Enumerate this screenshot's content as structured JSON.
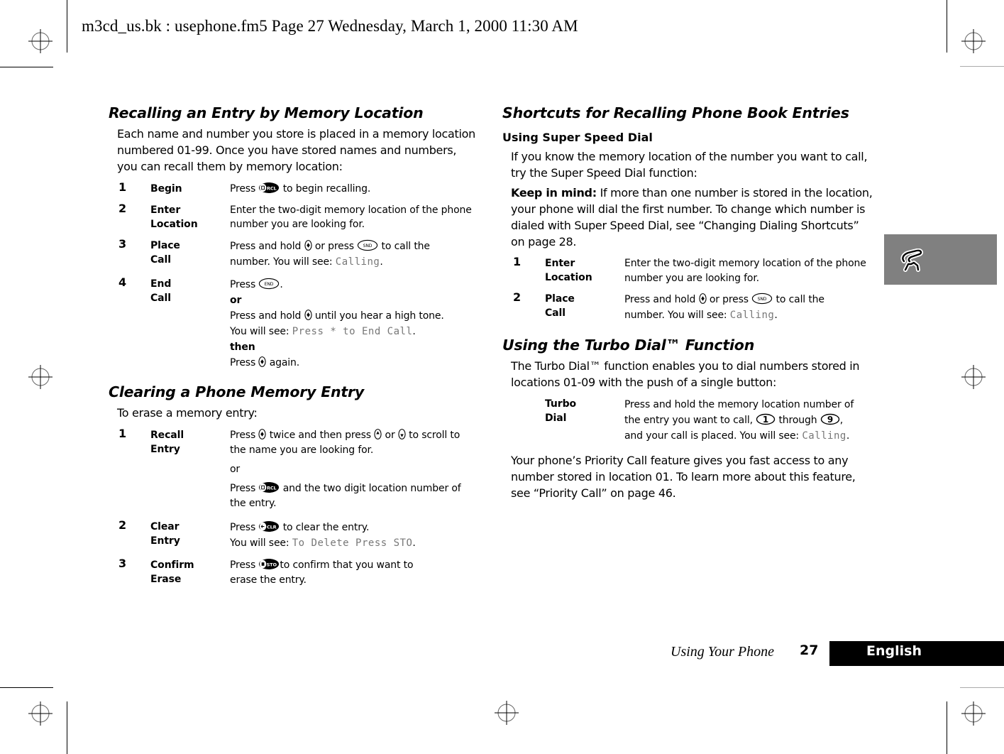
{
  "header": {
    "print_line": "m3cd_us.bk : usephone.fm5  Page 27  Wednesday, March 1, 2000  11:30 AM"
  },
  "left": {
    "recall_section": {
      "title": "Recalling an Entry by Memory Location",
      "intro_lines": [
        "Each name and number you store is placed in a memory location",
        "numbered 01-99. Once you have stored names and numbers,",
        "you can recall them by memory location:"
      ],
      "steps": [
        {
          "num": "1",
          "label": "Begin",
          "desc": {
            "pre": "Press ",
            "key": "rcl-key-icon",
            "post": " to begin recalling."
          }
        },
        {
          "num": "2",
          "label": "Enter\nLocation",
          "desc_lines": [
            "Enter the two-digit memory location of the phone",
            "number you are looking for."
          ]
        },
        {
          "num": "3",
          "label": "Place\nCall",
          "desc": {
            "l1_pre": "Press and hold ",
            "l1_mid": " or press ",
            "l1_post": " to call the",
            "l2_pre": "number. You will see: ",
            "l2_lcd": "Calling",
            "l2_post": "."
          }
        },
        {
          "num": "4",
          "label": "End\nCall",
          "desc": {
            "l1_pre": "Press ",
            "l1_post": ".",
            "or": "or",
            "l3_pre": "Press and hold ",
            "l3_post": " until you hear a high tone.",
            "l4_pre": "You will see: ",
            "l4_lcd": "Press * to End Call",
            "l4_post": ".",
            "then": "then",
            "l6_pre": "Press ",
            "l6_post": " again."
          }
        }
      ]
    },
    "clear_section": {
      "title": "Clearing a Phone Memory Entry",
      "intro": "To erase a memory entry:",
      "steps": [
        {
          "num": "1",
          "label": "Recall Entry",
          "desc": {
            "l1_pre": "Press ",
            "l1_mid1": " twice and then press ",
            "l1_mid2": " or ",
            "l1_post": " to scroll to",
            "l2": "the name you are looking for.",
            "or": "or",
            "l4_pre": "Press ",
            "l4_post": " and the two digit location number of",
            "l5": "the entry."
          }
        },
        {
          "num": "2",
          "label": "Clear Entry",
          "desc": {
            "l1_pre": "Press ",
            "l1_post": " to clear the entry.",
            "l2_pre": "You will see: ",
            "l2_lcd": "To Delete Press STO",
            "l2_post": "."
          }
        },
        {
          "num": "3",
          "label": "Confirm\nErase",
          "desc": {
            "l1_pre": "Press ",
            "l1_post": "to confirm that you want to",
            "l2": "erase the entry."
          }
        }
      ]
    }
  },
  "right": {
    "shortcuts_section": {
      "title": "Shortcuts for Recalling Phone Book Entries",
      "subtitle": "Using Super Speed Dial",
      "intro_lines": [
        "If you know the memory location of the number you want to call,",
        "try the Super Speed Dial function:"
      ],
      "note_label": "Keep in mind:",
      "note_lines": [
        " If more than one number is stored in the location,",
        "your phone will dial the first number. To change which number is",
        "dialed with Super Speed Dial, see “Changing Dialing Shortcuts”",
        "on page 28."
      ],
      "steps": [
        {
          "num": "1",
          "label": "Enter\nLocation",
          "desc_lines": [
            "Enter the two-digit memory location of the phone",
            "number you are looking for."
          ]
        },
        {
          "num": "2",
          "label": "Place\nCall",
          "desc": {
            "l1_pre": "Press and hold ",
            "l1_mid": " or press ",
            "l1_post": " to call the",
            "l2_pre": "number. You will see: ",
            "l2_lcd": "Calling",
            "l2_post": "."
          }
        }
      ]
    },
    "turbo_section": {
      "title": "Using the Turbo Dial™ Function",
      "intro_lines": [
        "The Turbo Dial™ function enables you to dial numbers stored in",
        "locations 01-09 with the push of a single button:"
      ],
      "step": {
        "label": "Turbo\nDial",
        "desc": {
          "l1": "Press and hold the memory location number of",
          "l2_pre": "the entry you want to call, ",
          "key1": "1",
          "l2_mid": " through ",
          "key2": "9",
          "l2_post": ",",
          "l3_pre": "and your call is placed. You will see: ",
          "l3_lcd": "Calling",
          "l3_post": "."
        }
      },
      "outro_lines": [
        "Your phone’s Priority Call feature gives you fast access to any",
        "number stored in location 01. To learn more about this feature,",
        "see “Priority Call” on page 46."
      ]
    }
  },
  "side_tab": {
    "icon": "phone-handset-icon",
    "color": "#808080"
  },
  "footer": {
    "chapter": "Using Your Phone",
    "page_number": "27",
    "language": "English"
  },
  "key_labels": {
    "rcl": "RCL",
    "snd": "SND",
    "end": "END",
    "clr": "CLR",
    "sto": "STO"
  }
}
